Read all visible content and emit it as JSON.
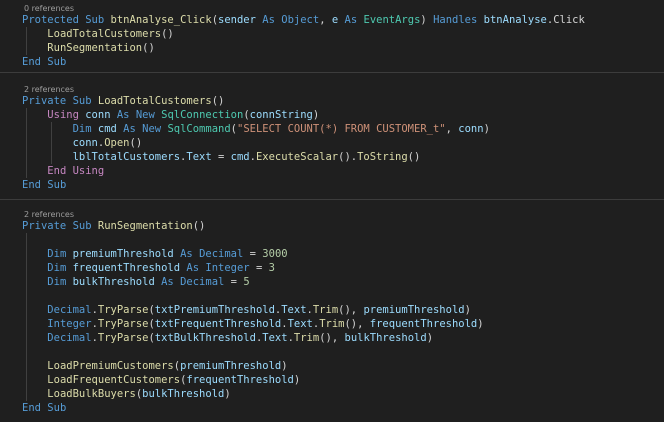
{
  "colors": {
    "background": "#1f1f1f",
    "keyword": "#569cd6",
    "control": "#c586c0",
    "type": "#4ec9b0",
    "method": "#dcdcaa",
    "variable": "#9cdcfe",
    "string": "#ce9178",
    "number": "#b5cea8",
    "plain": "#d4d4d4",
    "codelens": "#9d9d9d"
  },
  "blocks": [
    {
      "codelens": "0 references",
      "lines": [
        [
          {
            "t": "Protected",
            "c": "keyword"
          },
          {
            "t": " "
          },
          {
            "t": "Sub",
            "c": "keyword"
          },
          {
            "t": " "
          },
          {
            "t": "btnAnalyse_Click",
            "c": "method"
          },
          {
            "t": "("
          },
          {
            "t": "sender",
            "c": "variable"
          },
          {
            "t": " "
          },
          {
            "t": "As",
            "c": "keyword"
          },
          {
            "t": " "
          },
          {
            "t": "Object",
            "c": "keyword"
          },
          {
            "t": ", "
          },
          {
            "t": "e",
            "c": "variable"
          },
          {
            "t": " "
          },
          {
            "t": "As",
            "c": "keyword"
          },
          {
            "t": " "
          },
          {
            "t": "EventArgs",
            "c": "type"
          },
          {
            "t": ") "
          },
          {
            "t": "Handles",
            "c": "keyword"
          },
          {
            "t": " "
          },
          {
            "t": "btnAnalyse",
            "c": "variable"
          },
          {
            "t": "."
          },
          {
            "t": "Click",
            "c": "plain"
          }
        ],
        [
          {
            "t": "    "
          },
          {
            "t": "LoadTotalCustomers",
            "c": "method"
          },
          {
            "t": "()"
          }
        ],
        [
          {
            "t": "    "
          },
          {
            "t": "RunSegmentation",
            "c": "method"
          },
          {
            "t": "()"
          }
        ],
        [
          {
            "t": "End",
            "c": "keyword"
          },
          {
            "t": " "
          },
          {
            "t": "Sub",
            "c": "keyword"
          }
        ]
      ]
    },
    {
      "codelens": "2 references",
      "lines": [
        [
          {
            "t": "Private",
            "c": "keyword"
          },
          {
            "t": " "
          },
          {
            "t": "Sub",
            "c": "keyword"
          },
          {
            "t": " "
          },
          {
            "t": "LoadTotalCustomers",
            "c": "method"
          },
          {
            "t": "()"
          }
        ],
        [
          {
            "t": "    "
          },
          {
            "t": "Using",
            "c": "control"
          },
          {
            "t": " "
          },
          {
            "t": "conn",
            "c": "variable"
          },
          {
            "t": " "
          },
          {
            "t": "As",
            "c": "keyword"
          },
          {
            "t": " "
          },
          {
            "t": "New",
            "c": "keyword"
          },
          {
            "t": " "
          },
          {
            "t": "SqlConnection",
            "c": "type"
          },
          {
            "t": "("
          },
          {
            "t": "connString",
            "c": "variable"
          },
          {
            "t": ")"
          }
        ],
        [
          {
            "t": "        "
          },
          {
            "t": "Dim",
            "c": "keyword"
          },
          {
            "t": " "
          },
          {
            "t": "cmd",
            "c": "variable"
          },
          {
            "t": " "
          },
          {
            "t": "As",
            "c": "keyword"
          },
          {
            "t": " "
          },
          {
            "t": "New",
            "c": "keyword"
          },
          {
            "t": " "
          },
          {
            "t": "SqlCommand",
            "c": "type"
          },
          {
            "t": "("
          },
          {
            "t": "\"SELECT COUNT(*) FROM CUSTOMER_t\"",
            "c": "string"
          },
          {
            "t": ", "
          },
          {
            "t": "conn",
            "c": "variable"
          },
          {
            "t": ")"
          }
        ],
        [
          {
            "t": "        "
          },
          {
            "t": "conn",
            "c": "variable"
          },
          {
            "t": "."
          },
          {
            "t": "Open",
            "c": "method"
          },
          {
            "t": "()"
          }
        ],
        [
          {
            "t": "        "
          },
          {
            "t": "lblTotalCustomers",
            "c": "variable"
          },
          {
            "t": "."
          },
          {
            "t": "Text",
            "c": "variable"
          },
          {
            "t": " = "
          },
          {
            "t": "cmd",
            "c": "variable"
          },
          {
            "t": "."
          },
          {
            "t": "ExecuteScalar",
            "c": "method"
          },
          {
            "t": "()."
          },
          {
            "t": "ToString",
            "c": "method"
          },
          {
            "t": "()"
          }
        ],
        [
          {
            "t": "    "
          },
          {
            "t": "End",
            "c": "control"
          },
          {
            "t": " "
          },
          {
            "t": "Using",
            "c": "control"
          }
        ],
        [
          {
            "t": "End",
            "c": "keyword"
          },
          {
            "t": " "
          },
          {
            "t": "Sub",
            "c": "keyword"
          }
        ]
      ]
    },
    {
      "codelens": "2 references",
      "lines": [
        [
          {
            "t": "Private",
            "c": "keyword"
          },
          {
            "t": " "
          },
          {
            "t": "Sub",
            "c": "keyword"
          },
          {
            "t": " "
          },
          {
            "t": "RunSegmentation",
            "c": "method"
          },
          {
            "t": "()"
          }
        ],
        [],
        [
          {
            "t": "    "
          },
          {
            "t": "Dim",
            "c": "keyword"
          },
          {
            "t": " "
          },
          {
            "t": "premiumThreshold",
            "c": "variable"
          },
          {
            "t": " "
          },
          {
            "t": "As",
            "c": "keyword"
          },
          {
            "t": " "
          },
          {
            "t": "Decimal",
            "c": "keyword"
          },
          {
            "t": " = "
          },
          {
            "t": "3000",
            "c": "number"
          }
        ],
        [
          {
            "t": "    "
          },
          {
            "t": "Dim",
            "c": "keyword"
          },
          {
            "t": " "
          },
          {
            "t": "frequentThreshold",
            "c": "variable"
          },
          {
            "t": " "
          },
          {
            "t": "As",
            "c": "keyword"
          },
          {
            "t": " "
          },
          {
            "t": "Integer",
            "c": "keyword"
          },
          {
            "t": " = "
          },
          {
            "t": "3",
            "c": "number"
          }
        ],
        [
          {
            "t": "    "
          },
          {
            "t": "Dim",
            "c": "keyword"
          },
          {
            "t": " "
          },
          {
            "t": "bulkThreshold",
            "c": "variable"
          },
          {
            "t": " "
          },
          {
            "t": "As",
            "c": "keyword"
          },
          {
            "t": " "
          },
          {
            "t": "Decimal",
            "c": "keyword"
          },
          {
            "t": " = "
          },
          {
            "t": "5",
            "c": "number"
          }
        ],
        [],
        [
          {
            "t": "    "
          },
          {
            "t": "Decimal",
            "c": "keyword"
          },
          {
            "t": "."
          },
          {
            "t": "TryParse",
            "c": "method"
          },
          {
            "t": "("
          },
          {
            "t": "txtPremiumThreshold",
            "c": "variable"
          },
          {
            "t": "."
          },
          {
            "t": "Text",
            "c": "variable"
          },
          {
            "t": "."
          },
          {
            "t": "Trim",
            "c": "method"
          },
          {
            "t": "(), "
          },
          {
            "t": "premiumThreshold",
            "c": "variable"
          },
          {
            "t": ")"
          }
        ],
        [
          {
            "t": "    "
          },
          {
            "t": "Integer",
            "c": "keyword"
          },
          {
            "t": "."
          },
          {
            "t": "TryParse",
            "c": "method"
          },
          {
            "t": "("
          },
          {
            "t": "txtFrequentThreshold",
            "c": "variable"
          },
          {
            "t": "."
          },
          {
            "t": "Text",
            "c": "variable"
          },
          {
            "t": "."
          },
          {
            "t": "Trim",
            "c": "method"
          },
          {
            "t": "(), "
          },
          {
            "t": "frequentThreshold",
            "c": "variable"
          },
          {
            "t": ")"
          }
        ],
        [
          {
            "t": "    "
          },
          {
            "t": "Decimal",
            "c": "keyword"
          },
          {
            "t": "."
          },
          {
            "t": "TryParse",
            "c": "method"
          },
          {
            "t": "("
          },
          {
            "t": "txtBulkThreshold",
            "c": "variable"
          },
          {
            "t": "."
          },
          {
            "t": "Text",
            "c": "variable"
          },
          {
            "t": "."
          },
          {
            "t": "Trim",
            "c": "method"
          },
          {
            "t": "(), "
          },
          {
            "t": "bulkThreshold",
            "c": "variable"
          },
          {
            "t": ")"
          }
        ],
        [],
        [
          {
            "t": "    "
          },
          {
            "t": "LoadPremiumCustomers",
            "c": "method"
          },
          {
            "t": "("
          },
          {
            "t": "premiumThreshold",
            "c": "variable"
          },
          {
            "t": ")"
          }
        ],
        [
          {
            "t": "    "
          },
          {
            "t": "LoadFrequentCustomers",
            "c": "method"
          },
          {
            "t": "("
          },
          {
            "t": "frequentThreshold",
            "c": "variable"
          },
          {
            "t": ")"
          }
        ],
        [
          {
            "t": "    "
          },
          {
            "t": "LoadBulkBuyers",
            "c": "method"
          },
          {
            "t": "("
          },
          {
            "t": "bulkThreshold",
            "c": "variable"
          },
          {
            "t": ")"
          }
        ],
        [
          {
            "t": "End",
            "c": "keyword"
          },
          {
            "t": " "
          },
          {
            "t": "Sub",
            "c": "keyword"
          }
        ]
      ]
    }
  ]
}
